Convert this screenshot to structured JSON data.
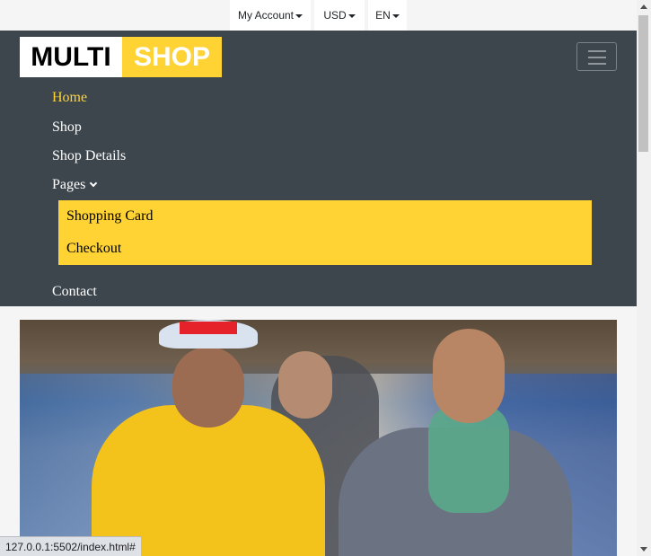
{
  "topbar": {
    "account_label": "My Account",
    "currency_label": "USD",
    "language_label": "EN"
  },
  "logo": {
    "part1": "MULTI",
    "part2": "SHOP"
  },
  "nav": {
    "items": [
      {
        "label": "Home",
        "active": true
      },
      {
        "label": "Shop"
      },
      {
        "label": "Shop Details"
      },
      {
        "label": "Pages"
      },
      {
        "label": "Contact"
      }
    ],
    "pages_submenu": [
      {
        "label": "Shopping Card"
      },
      {
        "label": "Checkout"
      }
    ]
  },
  "status_bar": {
    "url": "127.0.0.1:5502/index.html#"
  },
  "colors": {
    "accent": "#ffd333",
    "nav_bg": "#3d464d",
    "topbar_bg": "#f5f5f5"
  }
}
